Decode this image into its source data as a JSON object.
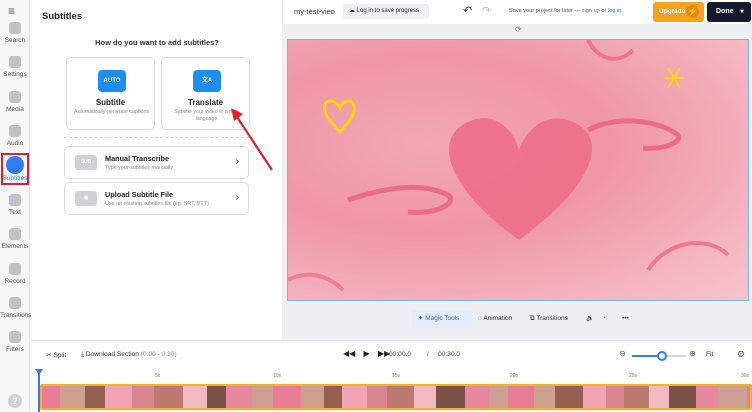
{
  "sidebar": {
    "menu_icon": "menu-icon",
    "items": [
      {
        "label": "Search",
        "icon": "search-icon"
      },
      {
        "label": "Settings",
        "icon": "settings-icon"
      },
      {
        "label": "Media",
        "icon": "media-icon"
      },
      {
        "label": "Audio",
        "icon": "audio-icon"
      },
      {
        "label": "Subtitles",
        "icon": "subtitles-icon",
        "active": true
      },
      {
        "label": "Text",
        "icon": "text-icon"
      },
      {
        "label": "Elements",
        "icon": "elements-icon"
      },
      {
        "label": "Record",
        "icon": "record-icon"
      },
      {
        "label": "Transitions",
        "icon": "transitions-icon"
      },
      {
        "label": "Filters",
        "icon": "filters-icon"
      }
    ],
    "help": "?"
  },
  "panel": {
    "title": "Subtitles",
    "question": "How do you want to add subtitles?",
    "cards": [
      {
        "icon_text": "AUTO",
        "title": "Subtitle",
        "desc": "Automatically generate captions"
      },
      {
        "icon_text": "文A",
        "title": "Translate",
        "desc": "Subtitle your video in a new language"
      }
    ],
    "rows": [
      {
        "icon_text": "SUB",
        "title": "Manual Transcribe",
        "desc": "Type your subtitles manually"
      },
      {
        "icon_text": "◉",
        "title": "Upload Subtitle File",
        "desc": "Use an existing subtitles file (eg. SRT, VTT)"
      }
    ]
  },
  "topbar": {
    "project_name": "my-test-vieo",
    "login_label": "Log in to save progress",
    "save_note_prefix": "Save your project for later —",
    "sign_up": "sign up",
    "or": "or",
    "log_in": "log in",
    "upgrade_label": "Upgrade",
    "done_label": "Done"
  },
  "canvas_toolbar": {
    "magic_tools": "Magic Tools",
    "animation": "Animation",
    "transitions": "Transitions"
  },
  "timeline": {
    "split_label": "Split",
    "download_label": "Download Section",
    "download_range": "(0:00 - 0:30)",
    "current_time": "00:00.0",
    "separator": "/",
    "total_time": "00:30.0",
    "zoom_level": 0.55,
    "fit_label": "Fit",
    "ruler_ticks": [
      "5s",
      "10s",
      "15s",
      "20s",
      "25s",
      "30s"
    ]
  },
  "colors": {
    "accent": "#2e7df6",
    "upgrade": "#f6a21a",
    "done": "#141a2e",
    "annotation": "#e0202a",
    "track_border": "#f0b323"
  }
}
